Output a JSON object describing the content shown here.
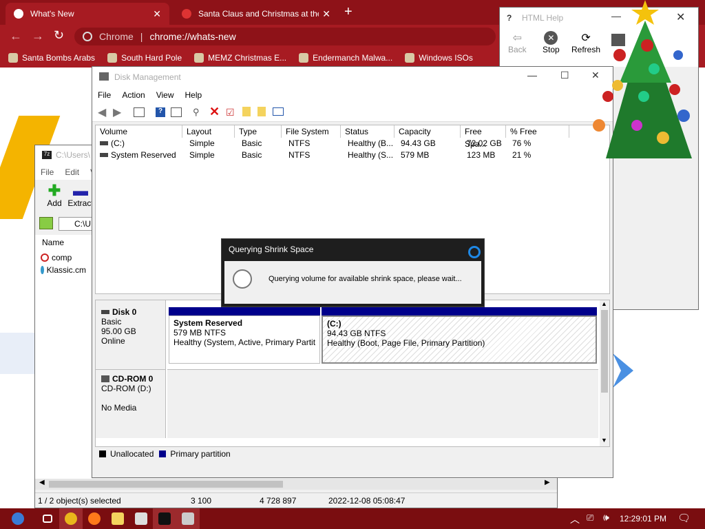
{
  "chrome": {
    "tabs": [
      {
        "title": "What's New",
        "active": true
      },
      {
        "title": "Santa Claus and Christmas at the",
        "active": false
      }
    ],
    "new_tab": "+",
    "omnibox_site": "Chrome",
    "omnibox_url": "chrome://whats-new",
    "bookmarks": [
      "Santa Bombs Arabs",
      "South Hard Pole",
      "MEMZ Christmas E...",
      "Endermanch Malwa...",
      "Windows ISOs"
    ]
  },
  "html_help": {
    "title": "HTML Help",
    "buttons": [
      "Back",
      "Stop",
      "Refresh"
    ]
  },
  "sevenzip": {
    "title": "C:\\Users\\",
    "menu": [
      "File",
      "Edit",
      "V"
    ],
    "toolbar": [
      "Add",
      "Extract"
    ],
    "path": "C:\\U",
    "column_name": "Name",
    "files": [
      "comp",
      "Klassic.cm"
    ],
    "status": {
      "selected": "1 / 2 object(s) selected",
      "size1": "3 100",
      "size2": "4 728 897",
      "date": "2022-12-08 05:08:47"
    }
  },
  "disk_mgmt": {
    "title": "Disk Management",
    "menu": [
      "File",
      "Action",
      "View",
      "Help"
    ],
    "columns": [
      "Volume",
      "Layout",
      "Type",
      "File System",
      "Status",
      "Capacity",
      "Free Spa...",
      "% Free"
    ],
    "rows": [
      [
        "(C:)",
        "Simple",
        "Basic",
        "NTFS",
        "Healthy (B...",
        "94.43 GB",
        "72.02 GB",
        "76 %"
      ],
      [
        "System Reserved",
        "Simple",
        "Basic",
        "NTFS",
        "Healthy (S...",
        "579 MB",
        "123 MB",
        "21 %"
      ]
    ],
    "disks": [
      {
        "name": "Disk 0",
        "type": "Basic",
        "size": "95.00 GB",
        "state": "Online"
      },
      {
        "name": "CD-ROM 0",
        "type": "CD-ROM (D:)",
        "size": "",
        "state": "No Media"
      }
    ],
    "partitions": [
      {
        "name": "System Reserved",
        "size": "579 MB NTFS",
        "status": "Healthy (System, Active, Primary Partiti"
      },
      {
        "name": "(C:)",
        "size": "94.43 GB NTFS",
        "status": "Healthy (Boot, Page File, Primary Partition)"
      }
    ],
    "legend": [
      "Unallocated",
      "Primary partition"
    ]
  },
  "dialog": {
    "title": "Querying Shrink Space",
    "message": "Querying volume for available shrink space, please wait..."
  },
  "taskbar": {
    "time": "12:29:01 PM"
  },
  "colors": {
    "chrome_frame": "#8e1218",
    "chrome_toolbar": "#a71b22",
    "taskbar": "#7a0d10",
    "primary_partition": "#00008b"
  }
}
